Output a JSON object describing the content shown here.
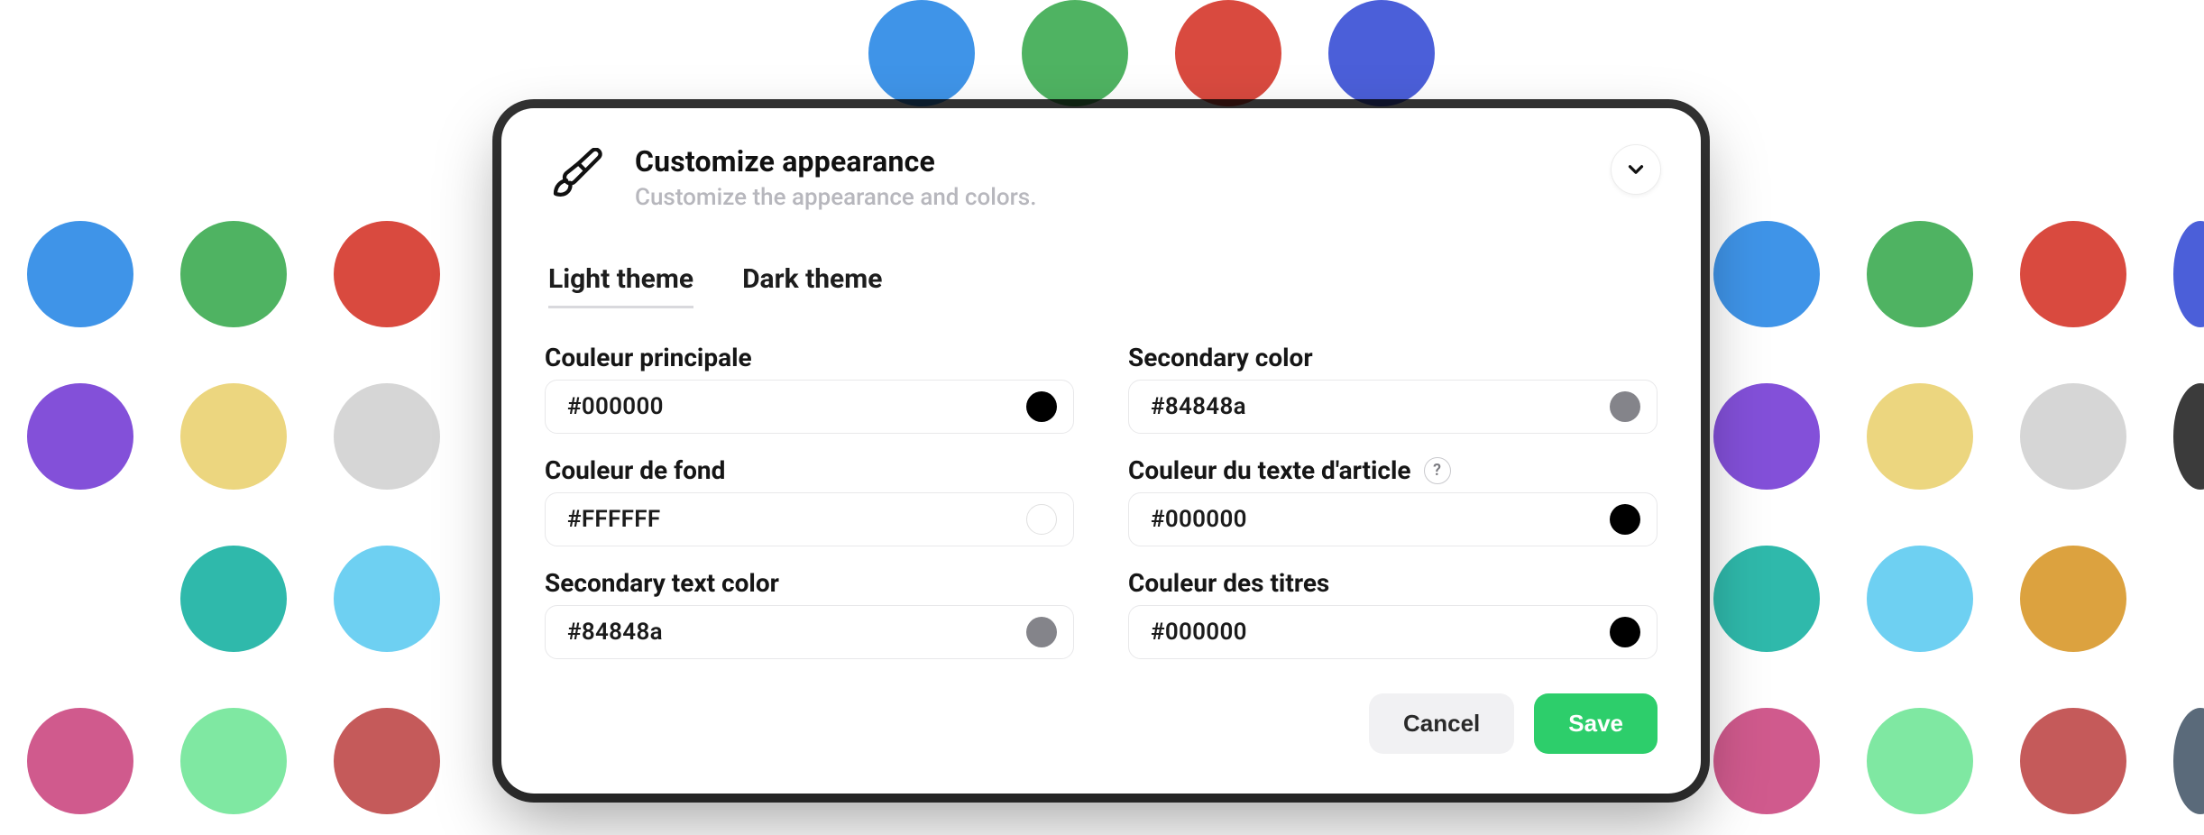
{
  "palette_top": [
    "#3f94e8",
    "#4fb362",
    "#d94a3f",
    "#4b5fd9"
  ],
  "palette_rows": [
    [
      "#3f94e8",
      "#4fb362",
      "#d94a3f",
      "#3f94e8",
      "#4fb362",
      "#d94a3f",
      "#4b5fd9"
    ],
    [
      "#8350d9",
      "#ecd67f",
      "#d6d6d6",
      "#8350d9",
      "#ecd67f",
      "#d6d6d6",
      "#3b3b3b"
    ],
    [
      "#2fb9ab",
      "#6ed0f2",
      "#2fb9ab",
      "#6ed0f2",
      "#dca23f"
    ],
    [
      "#d05a8d",
      "#7fe8a2",
      "#c55a5a",
      "#d05a8d",
      "#7fe8a2",
      "#c55a5a",
      "#5a6a7a"
    ]
  ],
  "header": {
    "title": "Customize appearance",
    "subtitle": "Customize the appearance and colors."
  },
  "tabs": {
    "light": "Light theme",
    "dark": "Dark theme"
  },
  "fields": {
    "primary": {
      "label": "Couleur principale",
      "value": "#000000",
      "swatch": "#000000"
    },
    "secondary": {
      "label": "Secondary color",
      "value": "#84848a",
      "swatch": "#84848a"
    },
    "bg": {
      "label": "Couleur de fond",
      "value": "#FFFFFF",
      "swatch": "#FFFFFF"
    },
    "article": {
      "label": "Couleur du texte d'article",
      "value": "#000000",
      "swatch": "#000000",
      "help": "?"
    },
    "sectext": {
      "label": "Secondary text color",
      "value": "#84848a",
      "swatch": "#84848a"
    },
    "titles": {
      "label": "Couleur des titres",
      "value": "#000000",
      "swatch": "#000000"
    }
  },
  "actions": {
    "cancel": "Cancel",
    "save": "Save"
  }
}
